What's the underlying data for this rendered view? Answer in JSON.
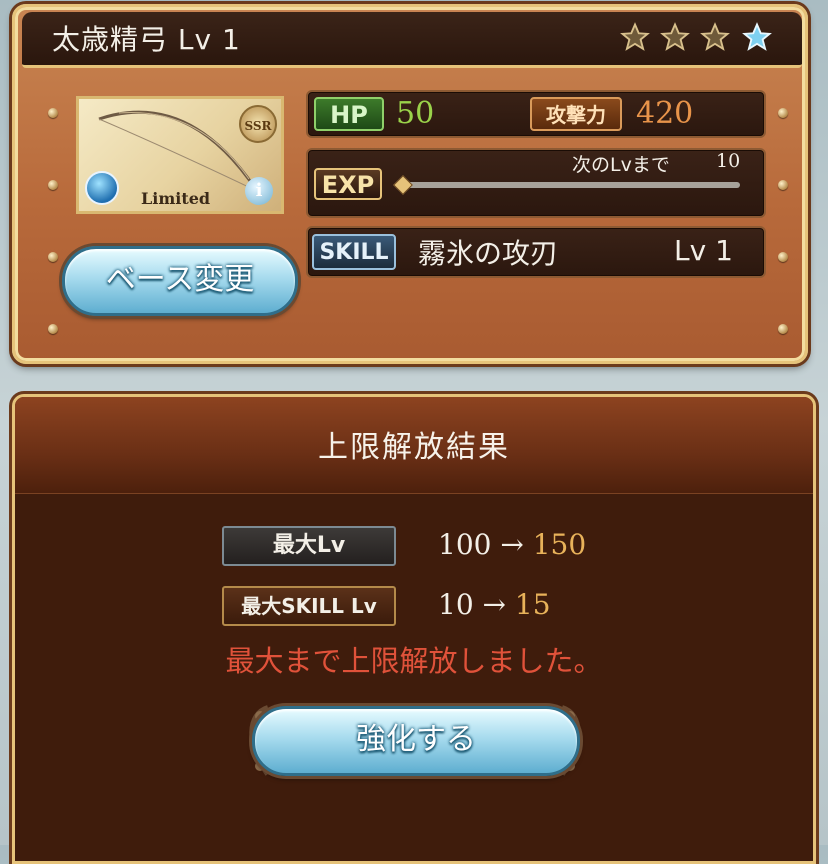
{
  "weapon": {
    "title": "太歳精弓 Lv 1",
    "stars_filled": 3,
    "stars_total": 4,
    "rarity": "SSR",
    "limited_label": "Limited",
    "element_icon": "water-element-icon",
    "info_icon": "info-icon"
  },
  "stats": {
    "hp_label": "HP",
    "hp_value": "50",
    "atk_label": "攻撃力",
    "atk_value": "420",
    "exp_label": "EXP",
    "next_lv_text": "次のLvまで",
    "next_lv_value": "10",
    "exp_progress": 0,
    "skill_label": "SKILL",
    "skill_name": "霧氷の攻刃",
    "skill_level": "Lv 1"
  },
  "buttons": {
    "change_base": "ベース変更",
    "enhance": "強化する"
  },
  "result": {
    "title": "上限解放結果",
    "max_lv_label": "最大Lv",
    "max_lv_from": "100",
    "max_lv_to": "150",
    "max_skill_label": "最大SKILL Lv",
    "max_skill_from": "10",
    "max_skill_to": "15",
    "arrow": "→",
    "message": "最大まで上限解放しました。"
  },
  "colors": {
    "hp_value": "#9ad24a",
    "atk_value": "#e8944a",
    "message": "#e0523a",
    "new_value": "#e8b25a"
  }
}
